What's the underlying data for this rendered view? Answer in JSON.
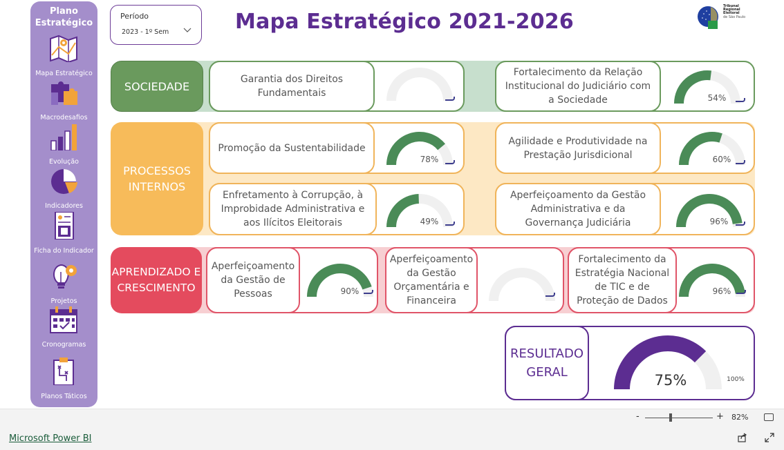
{
  "sidebar": {
    "title_line1": "Plano",
    "title_line2": "Estratégico",
    "items": [
      {
        "label": "Mapa Estratégico",
        "icon": "map-icon"
      },
      {
        "label": "Macrodesafios",
        "icon": "puzzle-icon"
      },
      {
        "label": "Evolução",
        "icon": "bar-chart-icon"
      },
      {
        "label": "Indicadores",
        "icon": "pie-chart-icon"
      },
      {
        "label": "Ficha do Indicador",
        "icon": "report-sheet-icon"
      },
      {
        "label": "Projetos",
        "icon": "lightbulb-gear-icon"
      },
      {
        "label": "Cronogramas",
        "icon": "calendar-icon"
      },
      {
        "label": "Planos Táticos",
        "icon": "clipboard-icon"
      }
    ]
  },
  "filter": {
    "label": "Período",
    "value": "2023 - 1º Sem"
  },
  "header": {
    "title": "Mapa Estratégico 2021-2026"
  },
  "logo": {
    "line1": "Tribunal",
    "line2": "Regional",
    "line3": "Eleitoral",
    "line4": "de São Paulo"
  },
  "colors": {
    "sidebar": "#a48ecb",
    "title": "#5c2d91",
    "gauge_fill": "#4a8b57",
    "gauge_track": "#f0f0f0",
    "sociedade": "#6a9a5d",
    "processos": "#f7bb5a",
    "aprendizado": "#e44b5e",
    "resultado": "#5c2d91"
  },
  "perspectives": {
    "sociedade": {
      "label": "SOCIEDADE",
      "cards": [
        {
          "text": "Garantia dos Direitos Fundamentais",
          "value": null,
          "percent_label": ""
        },
        {
          "text": "Fortalecimento da Relação Institucional do Judiciário com a Sociedade",
          "value": 54,
          "percent_label": "54%"
        }
      ]
    },
    "processos": {
      "label": "PROCESSOS INTERNOS",
      "cards": [
        {
          "text": "Promoção da Sustentabilidade",
          "value": 78,
          "percent_label": "78%"
        },
        {
          "text": "Agilidade e Produtividade na Prestação Jurisdicional",
          "value": 60,
          "percent_label": "60%"
        },
        {
          "text": "Enfretamento à Corrupção, à Improbidade Administrativa e aos Ilícitos Eleitorais",
          "value": 49,
          "percent_label": "49%"
        },
        {
          "text": "Aperfeiçoamento da Gestão Administrativa e da Governança Judiciária",
          "value": 96,
          "percent_label": "96%"
        }
      ]
    },
    "aprendizado": {
      "label": "APRENDIZADO E CRESCIMENTO",
      "cards": [
        {
          "text": "Aperfeiçoamento da Gestão de Pessoas",
          "value": 90,
          "percent_label": "90%"
        },
        {
          "text": "Aperfeiçoamento da Gestão Orçamentária e Financeira",
          "value": null,
          "percent_label": ""
        },
        {
          "text": "Fortalecimento da Estratégia Nacional de TIC e de Proteção de Dados",
          "value": 96,
          "percent_label": "96%"
        }
      ]
    }
  },
  "resultado": {
    "label": "RESULTADO GERAL",
    "value": 75,
    "percent_label": "75%",
    "max_label": "100%"
  },
  "footer": {
    "zoom_minus": "-",
    "zoom_plus": "+",
    "zoom_value": "82%",
    "powerbi_link": "Microsoft Power BI"
  }
}
